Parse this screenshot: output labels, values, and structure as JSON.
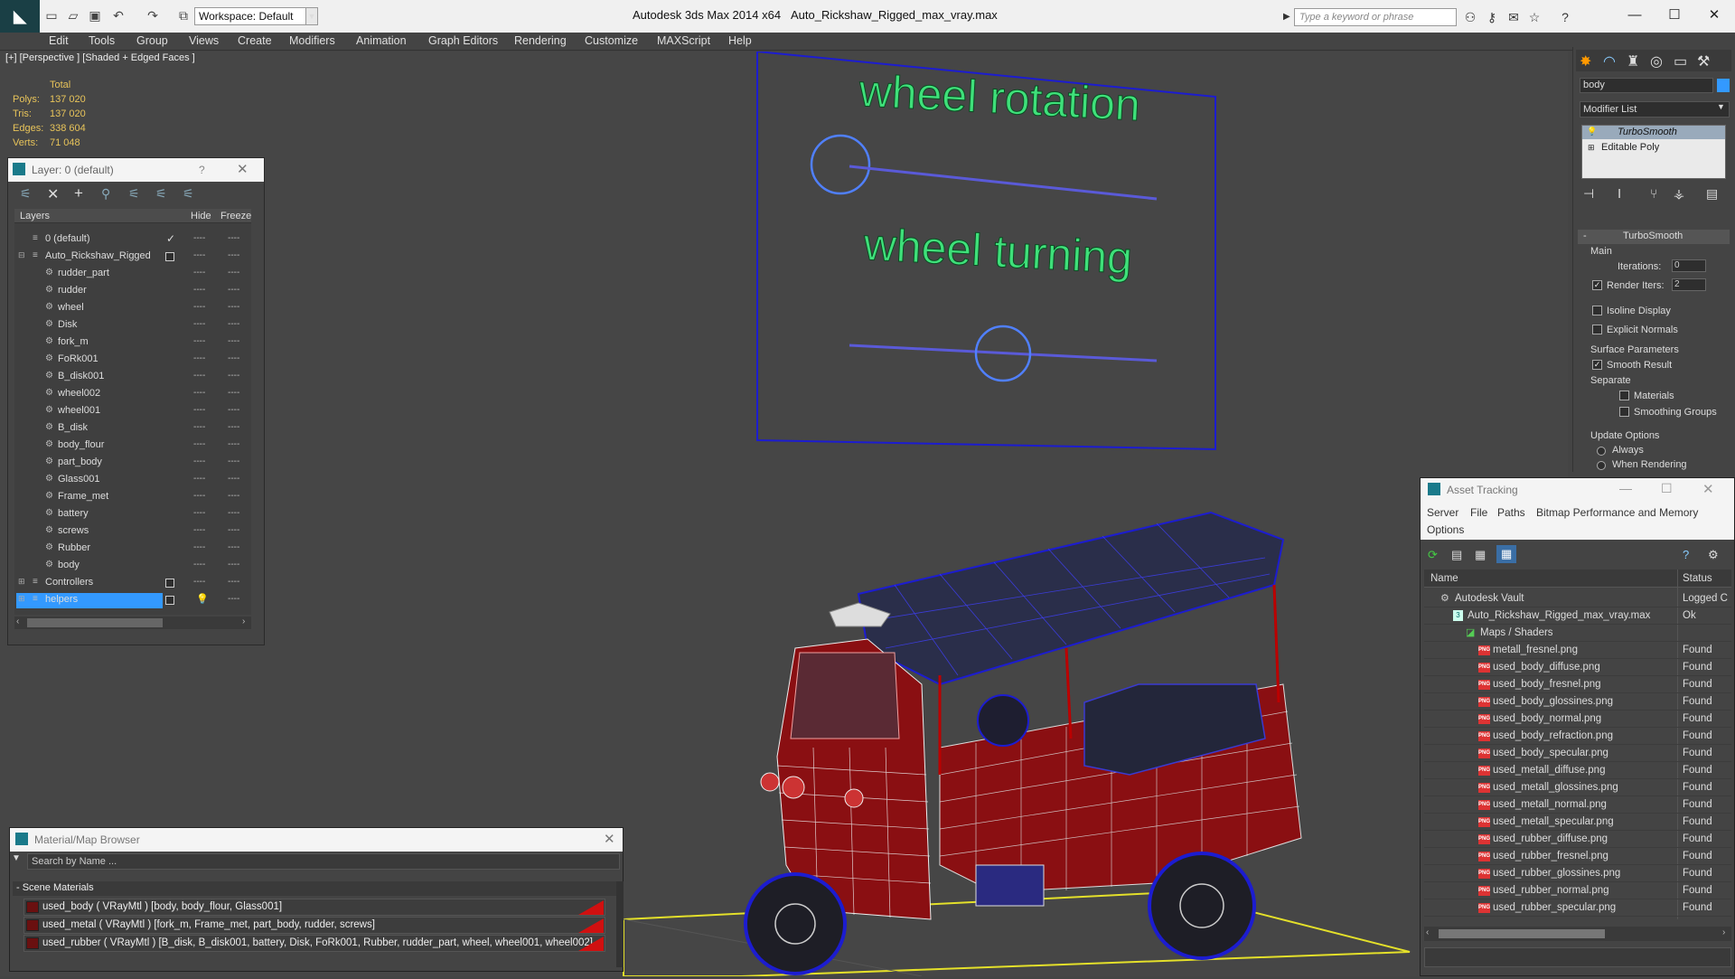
{
  "titlebar": {
    "app_title": "Autodesk 3ds Max  2014 x64",
    "file_title": "Auto_Rickshaw_Rigged_max_vray.max",
    "workspace": "Workspace: Default",
    "search_placeholder": "Type a keyword or phrase"
  },
  "menu": [
    "Edit",
    "Tools",
    "Group",
    "Views",
    "Create",
    "Modifiers",
    "Animation",
    "Graph Editors",
    "Rendering",
    "Customize",
    "MAXScript",
    "Help"
  ],
  "viewport": {
    "label": "[+] [Perspective ] [Shaded + Edged Faces ]",
    "stats": {
      "total_label": "Total",
      "polys_label": "Polys:",
      "polys": "137 020",
      "tris_label": "Tris:",
      "tris": "137 020",
      "edges_label": "Edges:",
      "edges": "338 604",
      "verts_label": "Verts:",
      "verts": "71 048"
    },
    "rig_text_1": "wheel rotation",
    "rig_text_2": "wheel turning"
  },
  "layer_panel": {
    "title": "Layer: 0 (default)",
    "help": "?",
    "col_layers": "Layers",
    "col_hide": "Hide",
    "col_freeze": "Freeze",
    "rows": [
      {
        "name": "0 (default)",
        "level": 1
      },
      {
        "name": "Auto_Rickshaw_Rigged",
        "level": 1
      },
      {
        "name": "rudder_part",
        "level": 2
      },
      {
        "name": "rudder",
        "level": 2
      },
      {
        "name": "wheel",
        "level": 2
      },
      {
        "name": "Disk",
        "level": 2
      },
      {
        "name": "fork_m",
        "level": 2
      },
      {
        "name": "FoRk001",
        "level": 2
      },
      {
        "name": "B_disk001",
        "level": 2
      },
      {
        "name": "wheel002",
        "level": 2
      },
      {
        "name": "wheel001",
        "level": 2
      },
      {
        "name": "B_disk",
        "level": 2
      },
      {
        "name": "body_flour",
        "level": 2
      },
      {
        "name": "part_body",
        "level": 2
      },
      {
        "name": "Glass001",
        "level": 2
      },
      {
        "name": "Frame_met",
        "level": 2
      },
      {
        "name": "battery",
        "level": 2
      },
      {
        "name": "screws",
        "level": 2
      },
      {
        "name": "Rubber",
        "level": 2
      },
      {
        "name": "body",
        "level": 2
      },
      {
        "name": "Controllers",
        "level": 1
      },
      {
        "name": "helpers",
        "level": 1
      }
    ]
  },
  "command_panel": {
    "object_name": "body",
    "modifier_list": "Modifier List",
    "stack": [
      "TurboSmooth",
      "Editable Poly"
    ],
    "rollout": "TurboSmooth",
    "main": "Main",
    "iterations_label": "Iterations:",
    "iterations": "0",
    "render_iters_label": "Render Iters:",
    "render_iters": "2",
    "isoline": "Isoline Display",
    "explicit_normals": "Explicit Normals",
    "surface_params": "Surface Parameters",
    "smooth_result": "Smooth Result",
    "separate": "Separate",
    "materials": "Materials",
    "smoothing_groups": "Smoothing Groups",
    "update_options": "Update Options",
    "always": "Always",
    "when_rendering": "When Rendering"
  },
  "asset_tracking": {
    "title": "Asset Tracking",
    "menu": [
      "Server",
      "File",
      "Paths",
      "Bitmap Performance and Memory"
    ],
    "menu2": "Options",
    "col_name": "Name",
    "col_status": "Status",
    "rows": [
      {
        "name": "Autodesk Vault",
        "status": "Logged C",
        "level": 1,
        "icon": "vault"
      },
      {
        "name": "Auto_Rickshaw_Rigged_max_vray.max",
        "status": "Ok",
        "level": 2,
        "icon": "max"
      },
      {
        "name": "Maps / Shaders",
        "status": "",
        "level": 3,
        "icon": "maps"
      },
      {
        "name": "metall_fresnel.png",
        "status": "Found",
        "level": 4,
        "icon": "png"
      },
      {
        "name": "used_body_diffuse.png",
        "status": "Found",
        "level": 4,
        "icon": "png"
      },
      {
        "name": "used_body_fresnel.png",
        "status": "Found",
        "level": 4,
        "icon": "png"
      },
      {
        "name": "used_body_glossines.png",
        "status": "Found",
        "level": 4,
        "icon": "png"
      },
      {
        "name": "used_body_normal.png",
        "status": "Found",
        "level": 4,
        "icon": "png"
      },
      {
        "name": "used_body_refraction.png",
        "status": "Found",
        "level": 4,
        "icon": "png"
      },
      {
        "name": "used_body_specular.png",
        "status": "Found",
        "level": 4,
        "icon": "png"
      },
      {
        "name": "used_metall_diffuse.png",
        "status": "Found",
        "level": 4,
        "icon": "png"
      },
      {
        "name": "used_metall_glossines.png",
        "status": "Found",
        "level": 4,
        "icon": "png"
      },
      {
        "name": "used_metall_normal.png",
        "status": "Found",
        "level": 4,
        "icon": "png"
      },
      {
        "name": "used_metall_specular.png",
        "status": "Found",
        "level": 4,
        "icon": "png"
      },
      {
        "name": "used_rubber_diffuse.png",
        "status": "Found",
        "level": 4,
        "icon": "png"
      },
      {
        "name": "used_rubber_fresnel.png",
        "status": "Found",
        "level": 4,
        "icon": "png"
      },
      {
        "name": "used_rubber_glossines.png",
        "status": "Found",
        "level": 4,
        "icon": "png"
      },
      {
        "name": "used_rubber_normal.png",
        "status": "Found",
        "level": 4,
        "icon": "png"
      },
      {
        "name": "used_rubber_specular.png",
        "status": "Found",
        "level": 4,
        "icon": "png"
      }
    ]
  },
  "material_browser": {
    "title": "Material/Map Browser",
    "search_placeholder": "Search by Name ...",
    "section": "- Scene Materials",
    "rows": [
      "used_body  ( VRayMtl ) [body, body_flour, Glass001]",
      "used_metal  ( VRayMtl ) [fork_m, Frame_met, part_body, rudder, screws]",
      "used_rubber  ( VRayMtl ) [B_disk, B_disk001, battery, Disk, FoRk001, Rubber, rudder_part, wheel, wheel001, wheel002]"
    ]
  },
  "colors": {
    "mesh_red": "#8a0f12",
    "wire_blue": "#1c1cd0",
    "rig_text": "#3fe07a",
    "grid_yellow": "#e4e02a",
    "selection_blue": "#3399ff"
  }
}
